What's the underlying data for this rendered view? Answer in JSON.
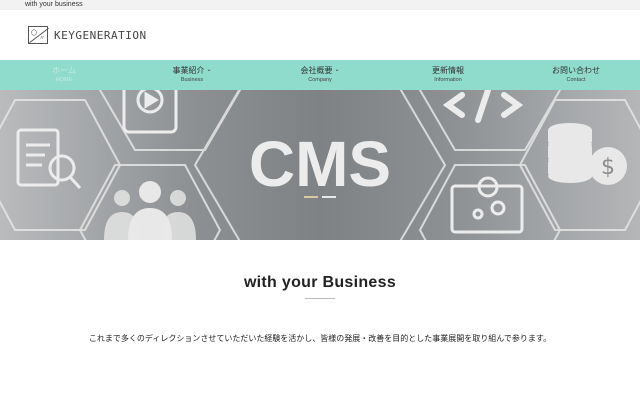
{
  "topbar": {
    "text": "with your business"
  },
  "header": {
    "logo_text": "KEYGENERATION",
    "logo_mark_a": "〇",
    "logo_mark_b": "〃"
  },
  "nav": {
    "items": [
      {
        "jp": "ホーム",
        "en": "HOME",
        "active": true
      },
      {
        "jp": "事業紹介",
        "en": "Business",
        "dropdown": true
      },
      {
        "jp": "会社概要",
        "en": "Company",
        "dropdown": true
      },
      {
        "jp": "更新情報",
        "en": "Information"
      },
      {
        "jp": "お問い合わせ",
        "en": "Contact"
      }
    ],
    "chevron": "⌄"
  },
  "hero": {
    "text": "CMS"
  },
  "main": {
    "title": "with your Business",
    "description": "これまで多くのディレクションさせていただいた経験を活かし、皆様の発展・改善を目的とした事業展開を取り組んで参ります。"
  },
  "colors": {
    "nav_bg": "#8fdccd",
    "accent": "#d7c9a2"
  }
}
